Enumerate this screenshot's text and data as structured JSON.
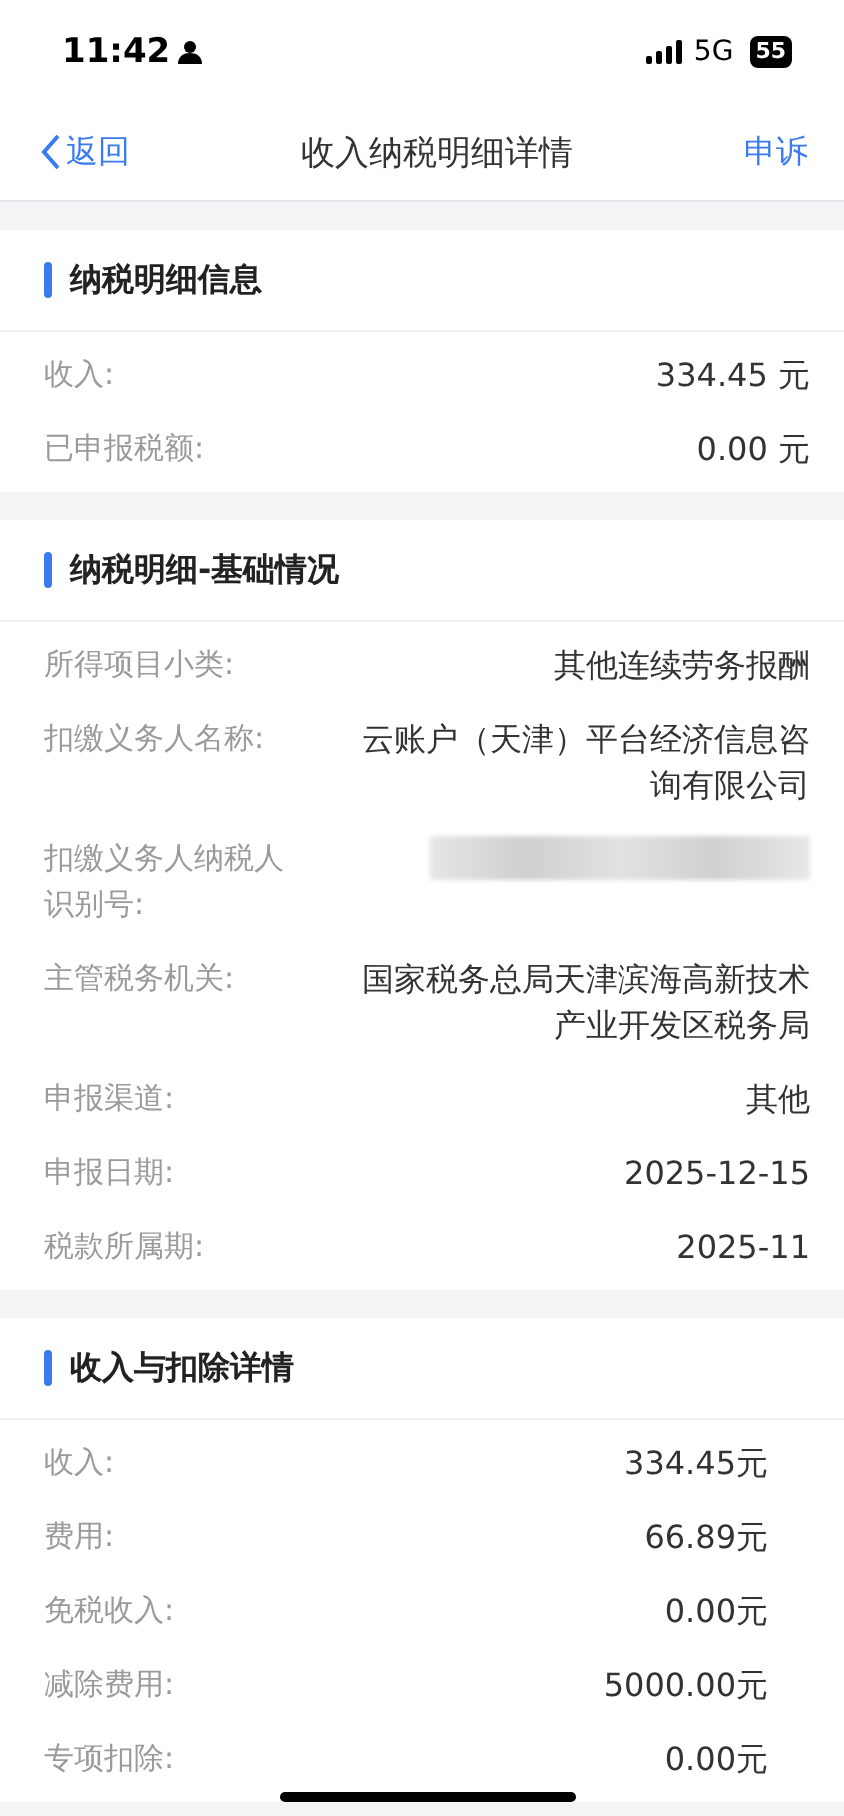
{
  "status_bar": {
    "time": "11:42",
    "network": "5G",
    "battery": "55"
  },
  "nav": {
    "back": "返回",
    "title": "收入纳税明细详情",
    "action": "申诉"
  },
  "sections": [
    {
      "kind": "detail",
      "title": "纳税明细信息",
      "rows": [
        {
          "kind": "text",
          "label": "收入:",
          "value": "334.45 元"
        },
        {
          "kind": "text",
          "label": "已申报税额:",
          "value": "0.00 元"
        }
      ]
    },
    {
      "kind": "detail",
      "title": "纳税明细-基础情况",
      "rows": [
        {
          "kind": "text",
          "label": "所得项目小类:",
          "value": "其他连续劳务报酬"
        },
        {
          "kind": "text",
          "label": "扣缴义务人名称:",
          "value": "云账户（天津）平台经济信息咨询有限公司"
        },
        {
          "kind": "blurred",
          "label": "扣缴义务人纳税人识别号:"
        },
        {
          "kind": "text",
          "label": "主管税务机关:",
          "value": "国家税务总局天津滨海高新技术产业开发区税务局"
        },
        {
          "kind": "text",
          "label": "申报渠道:",
          "value": "其他"
        },
        {
          "kind": "text",
          "label": "申报日期:",
          "value": "2025-12-15"
        },
        {
          "kind": "text",
          "label": "税款所属期:",
          "value": "2025-11"
        }
      ]
    },
    {
      "kind": "amount",
      "title": "收入与扣除详情",
      "rows": [
        {
          "kind": "text",
          "label": "收入:",
          "value": "334.45元"
        },
        {
          "kind": "text",
          "label": "费用:",
          "value": "66.89元"
        },
        {
          "kind": "text",
          "label": "免税收入:",
          "value": "0.00元"
        },
        {
          "kind": "text",
          "label": "减除费用:",
          "value": "5000.00元"
        },
        {
          "kind": "text",
          "label": "专项扣除:",
          "value": "0.00元"
        }
      ]
    }
  ]
}
